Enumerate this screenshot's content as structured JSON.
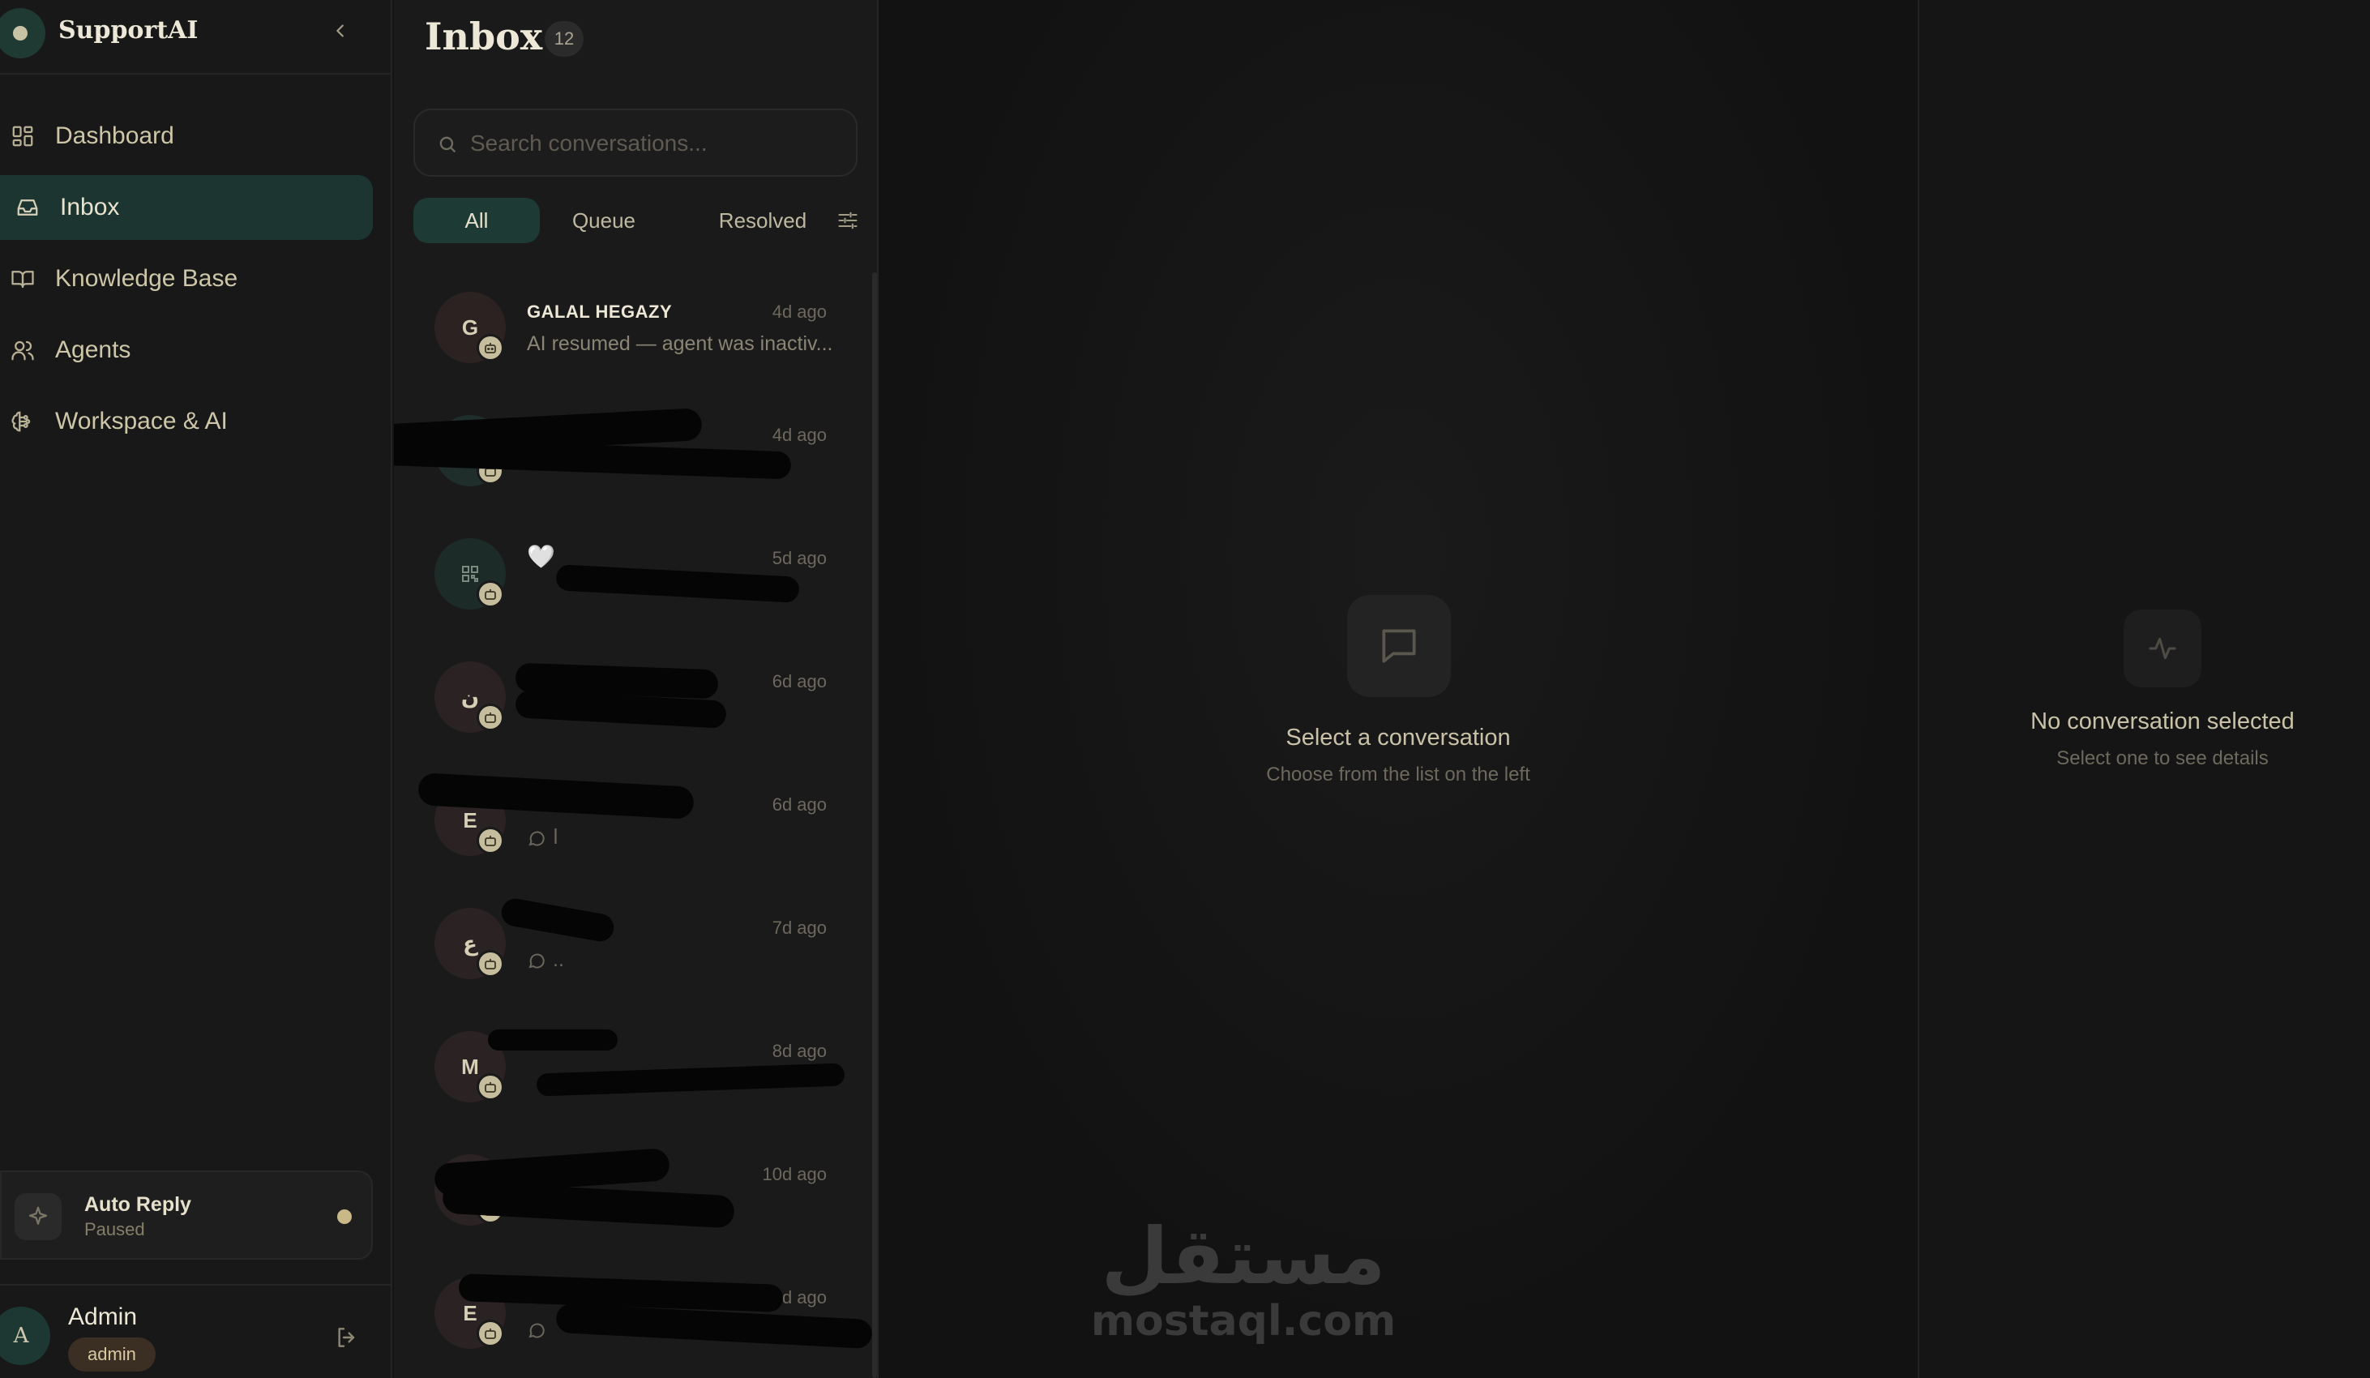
{
  "brand": {
    "name": "SupportAI"
  },
  "nav": [
    {
      "label": "Dashboard",
      "icon": "grid-icon"
    },
    {
      "label": "Inbox",
      "icon": "inbox-icon",
      "active": true
    },
    {
      "label": "Knowledge Base",
      "icon": "book-icon"
    },
    {
      "label": "Agents",
      "icon": "users-icon"
    },
    {
      "label": "Workspace & AI",
      "icon": "brain-icon"
    }
  ],
  "auto_reply": {
    "title": "Auto Reply",
    "status": "Paused"
  },
  "user": {
    "initial": "A",
    "name": "Admin",
    "role": "admin"
  },
  "inbox": {
    "title": "Inbox",
    "count": "12",
    "search_placeholder": "Search conversations...",
    "tabs": [
      "All",
      "Queue",
      "Resolved"
    ],
    "conversations": [
      {
        "initial": "G",
        "name": "GALAL HEGAZY",
        "time": "4d ago",
        "preview": "AI resumed — agent was inactiv..."
      },
      {
        "initial": "",
        "name": "",
        "time": "4d ago",
        "preview": ""
      },
      {
        "initial": "",
        "name": "🤍",
        "time": "5d ago",
        "preview": ""
      },
      {
        "initial": "ن",
        "name": "",
        "time": "6d ago",
        "preview": ""
      },
      {
        "initial": "E",
        "name": "",
        "time": "6d ago",
        "preview": "ا"
      },
      {
        "initial": "ع",
        "name": "",
        "time": "7d ago",
        "preview": ".."
      },
      {
        "initial": "M",
        "name": "",
        "time": "8d ago",
        "preview": ""
      },
      {
        "initial": "",
        "name": "",
        "time": "10d ago",
        "preview": ""
      },
      {
        "initial": "E",
        "name": "",
        "time": "10d ago",
        "preview": ""
      }
    ]
  },
  "main": {
    "empty_title": "Select a conversation",
    "empty_subtitle": "Choose from the list on the left",
    "watermark_ar": "مستقل",
    "watermark_en": "mostaql.com"
  },
  "details": {
    "empty_title": "No conversation selected",
    "empty_subtitle": "Select one to see details"
  }
}
